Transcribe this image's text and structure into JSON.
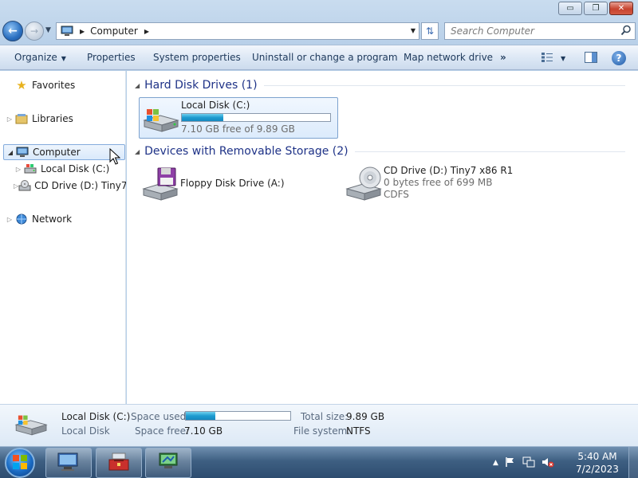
{
  "window": {
    "minimize_label": "▭",
    "restore_label": "❐",
    "close_label": "✕"
  },
  "address_bar": {
    "path_item": "Computer",
    "search_placeholder": "Search Computer"
  },
  "command_bar": {
    "organize": "Organize",
    "properties": "Properties",
    "system_properties": "System properties",
    "uninstall": "Uninstall or change a program",
    "map_network": "Map network drive",
    "more": "»",
    "help": "?"
  },
  "nav_pane": {
    "favorites": "Favorites",
    "libraries": "Libraries",
    "computer": "Computer",
    "local_disk": "Local Disk (C:)",
    "cd_drive": "CD Drive (D:) Tiny7 ›",
    "network": "Network"
  },
  "content": {
    "hdd_group": "Hard Disk Drives (1)",
    "removable_group": "Devices with Removable Storage (2)",
    "local_disk": {
      "name": "Local Disk (C:)",
      "free_text": "7.10 GB free of 9.89 GB",
      "used_fraction": 0.282
    },
    "floppy": {
      "name": "Floppy Disk Drive (A:)"
    },
    "cd": {
      "name": "CD Drive (D:) Tiny7 x86 R1",
      "free_text": "0 bytes free of 699 MB",
      "fs": "CDFS"
    }
  },
  "details": {
    "name": "Local Disk (C:)",
    "type": "Local Disk",
    "space_used_label": "Space used:",
    "space_free_label": "Space free:",
    "space_free_value": "7.10 GB",
    "total_size_label": "Total size:",
    "total_size_value": "9.89 GB",
    "file_system_label": "File system:",
    "file_system_value": "NTFS"
  },
  "taskbar": {
    "time": "5:40 AM",
    "date": "7/2/2023"
  },
  "colors": {
    "accent": "#1e9bd0",
    "group_header": "#1e3287"
  }
}
